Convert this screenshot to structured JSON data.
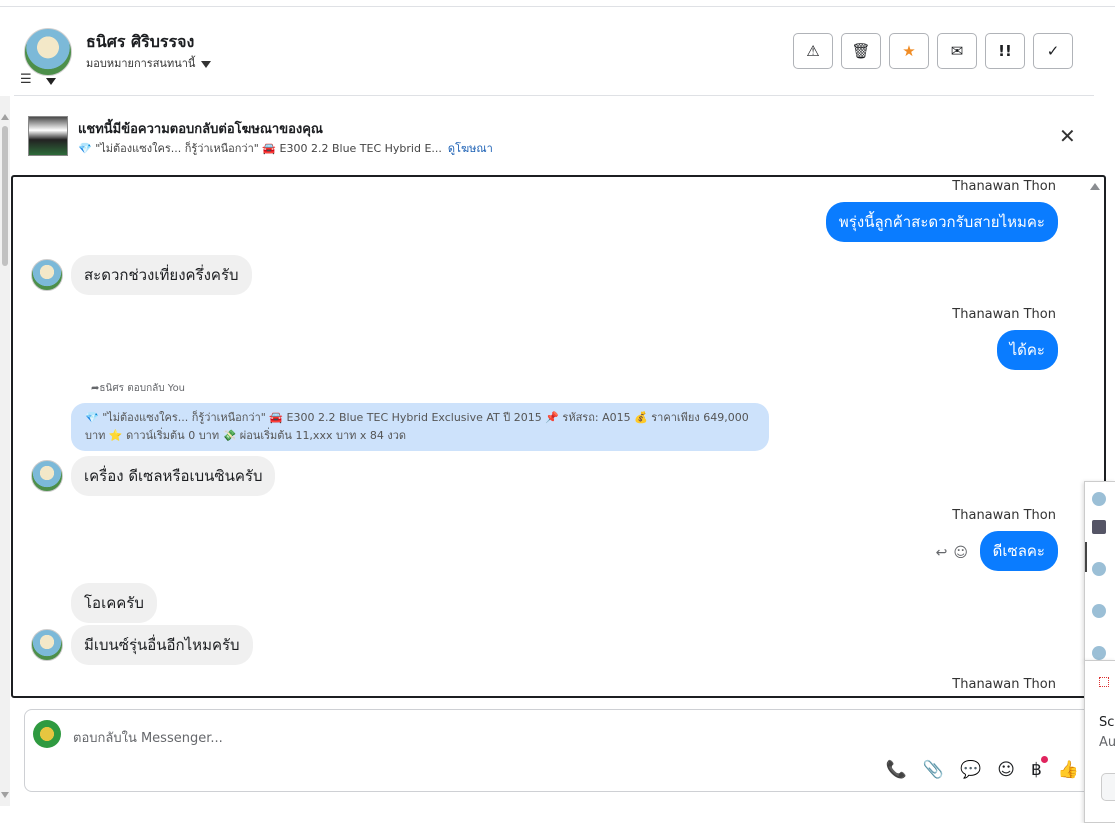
{
  "header": {
    "contact_name": "ธนิศร ศิริบรรจง",
    "assign_label": "มอบหมายการสนทนานี้",
    "actions": [
      {
        "icon": "warning-icon",
        "glyph": "⚠"
      },
      {
        "icon": "trash-icon",
        "glyph": "🗑"
      },
      {
        "icon": "star-icon",
        "glyph": "★"
      },
      {
        "icon": "mail-open-icon",
        "glyph": "✉"
      },
      {
        "icon": "priority-icon",
        "glyph": "!!"
      },
      {
        "icon": "check-icon",
        "glyph": "✓"
      }
    ]
  },
  "ad_banner": {
    "title": "แชทนี้มีข้อความตอบกลับต่อโฆษณาของคุณ",
    "snippet": "💎 \"ไม่ต้องแซงใคร... ก็รู้ว่าเหนือกว่า\" 🚘 E300 2.2 Blue TEC Hybrid E...",
    "link": "ดูโฆษณา"
  },
  "messages": {
    "sender_name": "Thanawan Thon",
    "m1": "พรุ่งนี้ลูกค้าสะดวกรับสายไหมคะ",
    "m2": "สะดวกช่วงเที่ยงครึ่งครับ",
    "m3": "ได้คะ",
    "reply_note": "ธนิศร ตอบกลับ You",
    "quoted": "💎 \"ไม่ต้องแซงใคร... ก็รู้ว่าเหนือกว่า\" 🚘 E300 2.2 Blue TEC Hybrid Exclusive AT ปี 2015 📌 รหัสรถ: A015 💰 ราคาเพียง 649,000 บาท ⭐ ดาวน์เริ่มต้น 0 บาท 💸 ผ่อนเริ่มต้น 11,xxx บาท x 84 งวด",
    "m4": "เครื่อง  ดีเซลหรือเบนซินครับ",
    "m5": "ดีเซลคะ",
    "m6": "โอเคครับ",
    "m7": "มีเบนซ์รุ่นอื่นอีกไหมครับ"
  },
  "composer": {
    "placeholder": "ตอบกลับใน Messenger...",
    "tools": [
      "call-add-icon",
      "attachment-icon",
      "saved-reply-icon",
      "emoji-icon",
      "payment-icon",
      "like-icon"
    ]
  },
  "side_popup": {
    "line1": "Sc",
    "line2": "Au"
  }
}
